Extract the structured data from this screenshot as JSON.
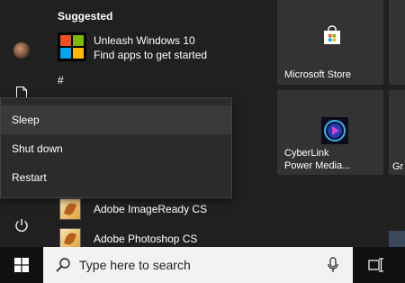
{
  "suggested_header": "Suggested",
  "suggestion": {
    "title": "Unleash Windows 10",
    "subtitle": "Find apps to get started",
    "icon": "microsoft-logo-icon",
    "logo_colors": [
      "#f25022",
      "#7fba00",
      "#00a4ef",
      "#ffb900"
    ]
  },
  "letter_header": "#",
  "power_menu": {
    "items": [
      {
        "label": "Sleep",
        "hovered": true
      },
      {
        "label": "Shut down",
        "hovered": false
      },
      {
        "label": "Restart",
        "hovered": false
      }
    ]
  },
  "apps": [
    {
      "label": "Adobe ImageReady CS",
      "icon": "adobe-imageready-icon"
    },
    {
      "label": "Adobe Photoshop CS",
      "icon": "adobe-photoshop-icon"
    }
  ],
  "tiles": {
    "store": {
      "label": "Microsoft Store",
      "icon": "store-bag-icon"
    },
    "cyberlink": {
      "label_line1": "CyberLink",
      "label_line2": "Power Media...",
      "icon": "cyberlink-icon"
    },
    "partial": {
      "label": "Gr"
    }
  },
  "rail": {
    "icons": [
      "avatar",
      "document-icon",
      "power-icon"
    ]
  },
  "taskbar": {
    "search_placeholder": "Type here to search",
    "icons": [
      "windows-logo-icon",
      "search-icon",
      "microphone-icon",
      "task-view-icon"
    ]
  },
  "colors": {
    "accent_start_bg": "#202020",
    "tile_bg": "#333333",
    "taskbar_bg": "#101010",
    "search_bg": "#f2f2f2"
  }
}
